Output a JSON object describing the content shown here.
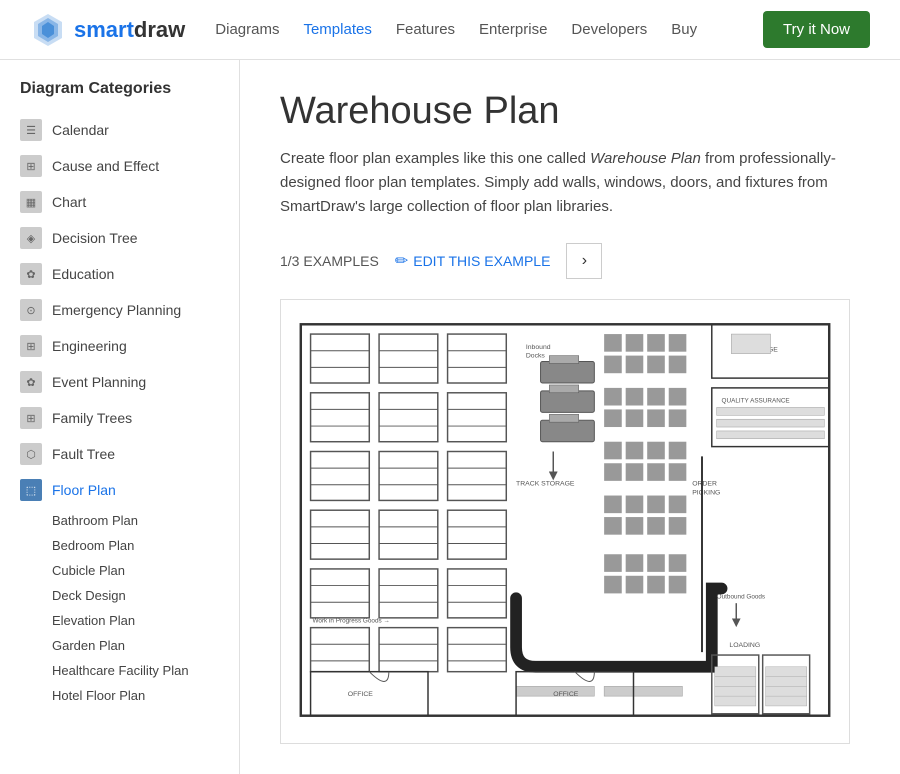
{
  "header": {
    "logo_bold": "smart",
    "logo_light": "draw",
    "nav_items": [
      {
        "label": "Diagrams",
        "active": false
      },
      {
        "label": "Templates",
        "active": true
      },
      {
        "label": "Features",
        "active": false
      },
      {
        "label": "Enterprise",
        "active": false
      },
      {
        "label": "Developers",
        "active": false
      },
      {
        "label": "Buy",
        "active": false
      }
    ],
    "try_button": "Try it Now"
  },
  "sidebar": {
    "title": "Diagram Categories",
    "items": [
      {
        "label": "Calendar",
        "icon": "☰",
        "active": false
      },
      {
        "label": "Cause and Effect",
        "icon": "⊞",
        "active": false
      },
      {
        "label": "Chart",
        "icon": "▦",
        "active": false
      },
      {
        "label": "Decision Tree",
        "icon": "◈",
        "active": false
      },
      {
        "label": "Education",
        "icon": "✿",
        "active": false
      },
      {
        "label": "Emergency Planning",
        "icon": "⊙",
        "active": false
      },
      {
        "label": "Engineering",
        "icon": "⊞",
        "active": false
      },
      {
        "label": "Event Planning",
        "icon": "✿",
        "active": false
      },
      {
        "label": "Family Trees",
        "icon": "⊞",
        "active": false
      },
      {
        "label": "Fault Tree",
        "icon": "⬡",
        "active": false
      },
      {
        "label": "Floor Plan",
        "icon": "⬚",
        "active": true
      }
    ],
    "sub_items": [
      "Bathroom Plan",
      "Bedroom Plan",
      "Cubicle Plan",
      "Deck Design",
      "Elevation Plan",
      "Garden Plan",
      "Healthcare Facility Plan",
      "Hotel Floor Plan"
    ]
  },
  "main": {
    "title": "Warehouse Plan",
    "description": "Create floor plan examples like this one called Warehouse Plan from professionally-designed floor plan templates. Simply add walls, windows, doors, and fixtures from SmartDraw's large collection of floor plan libraries.",
    "example_counter": "1/3 EXAMPLES",
    "edit_label": "EDIT THIS EXAMPLE",
    "next_label": "›"
  }
}
